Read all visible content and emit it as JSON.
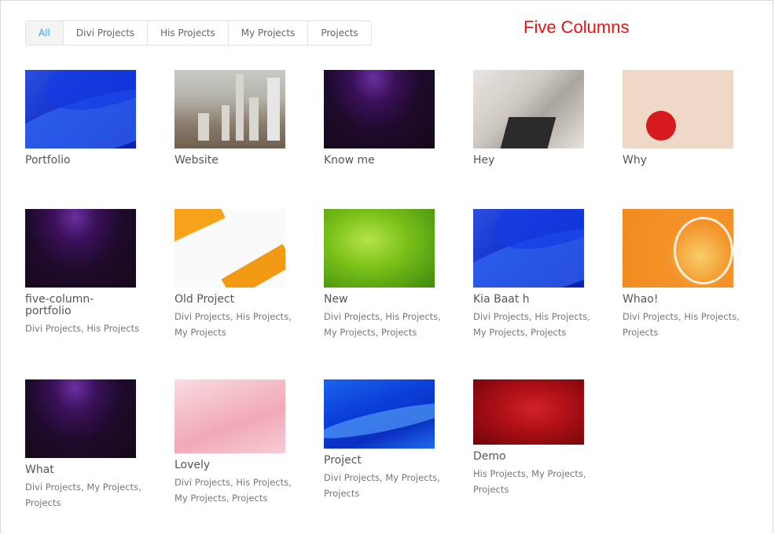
{
  "filters": [
    {
      "label": "All",
      "active": true
    },
    {
      "label": "Divi Projects",
      "active": false
    },
    {
      "label": "His Projects",
      "active": false
    },
    {
      "label": "My Projects",
      "active": false
    },
    {
      "label": "Projects",
      "active": false
    }
  ],
  "heading": "Five Columns",
  "items": [
    {
      "title": "Portfolio",
      "categories": ""
    },
    {
      "title": "Website",
      "categories": ""
    },
    {
      "title": "Know me",
      "categories": ""
    },
    {
      "title": "Hey",
      "categories": ""
    },
    {
      "title": "Why",
      "categories": ""
    },
    {
      "title": "five-column-portfolio",
      "categories": "Divi Projects, His Projects"
    },
    {
      "title": "Old Project",
      "categories": "Divi Projects, His Projects, My Projects"
    },
    {
      "title": "New",
      "categories": "Divi Projects, His Projects, My Projects, Projects"
    },
    {
      "title": "Kia Baat h",
      "categories": "Divi Projects, His Projects, My Projects, Projects"
    },
    {
      "title": "Whao!",
      "categories": "Divi Projects, His Projects, Projects"
    },
    {
      "title": "What",
      "categories": "Divi Projects, My Projects, Projects"
    },
    {
      "title": "Lovely",
      "categories": "Divi Projects, His Projects, My Projects, Projects"
    },
    {
      "title": "Project",
      "categories": "Divi Projects, My Projects, Projects"
    },
    {
      "title": "Demo",
      "categories": "His Projects, My Projects, Projects"
    }
  ],
  "colors": {
    "accent": "#2ea3f2",
    "heading": "#ee1111"
  }
}
